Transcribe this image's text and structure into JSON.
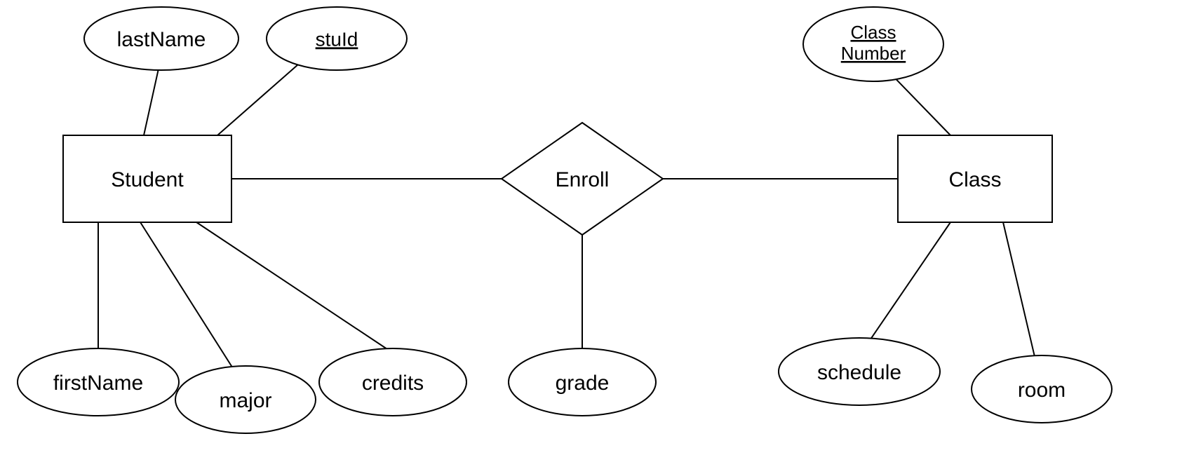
{
  "diagram": {
    "entities": {
      "student": {
        "label": "Student"
      },
      "class": {
        "label": "Class"
      }
    },
    "relationship": {
      "enroll": {
        "label": "Enroll"
      }
    },
    "attributes": {
      "lastName": {
        "label": "lastName",
        "key": false
      },
      "stuId": {
        "label": "stuId",
        "key": true
      },
      "firstName": {
        "label": "firstName",
        "key": false
      },
      "major": {
        "label": "major",
        "key": false
      },
      "credits": {
        "label": "credits",
        "key": false
      },
      "grade": {
        "label": "grade",
        "key": false
      },
      "classNumber": {
        "label_line1": "Class",
        "label_line2": "Number",
        "key": true
      },
      "schedule": {
        "label": "schedule",
        "key": false
      },
      "room": {
        "label": "room",
        "key": false
      }
    }
  }
}
